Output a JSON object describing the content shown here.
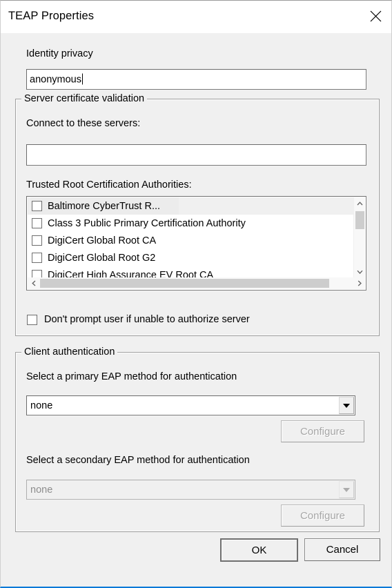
{
  "window": {
    "title": "TEAP Properties",
    "close_icon": "close-icon"
  },
  "identity_privacy": {
    "label": "Identity privacy",
    "value": "anonymous",
    "placeholder": ""
  },
  "server_certificate_validation": {
    "group_title": "Server certificate validation",
    "connect_label": "Connect to these servers:",
    "connect_value": "",
    "connect_placeholder": "",
    "trusted_roots_label": "Trusted Root Certification Authorities:",
    "trusted_roots": [
      {
        "label": "Baltimore CyberTrust R...",
        "checked": false,
        "selected": true
      },
      {
        "label": "Class 3 Public Primary Certification Authority",
        "checked": false,
        "selected": false
      },
      {
        "label": "DigiCert Global Root CA",
        "checked": false,
        "selected": false
      },
      {
        "label": "DigiCert Global Root G2",
        "checked": false,
        "selected": false
      },
      {
        "label": "DigiCert High Assurance EV Root CA",
        "checked": false,
        "selected": false
      }
    ],
    "scroll_up_icon": "chevron-up-icon",
    "scroll_down_icon": "chevron-down-icon",
    "scroll_left_icon": "chevron-left-icon",
    "scroll_right_icon": "chevron-right-icon",
    "dont_prompt_label": "Don't prompt user if unable to authorize server",
    "dont_prompt_checked": false
  },
  "client_authentication": {
    "group_title": "Client authentication",
    "primary_label": "Select a primary EAP method for authentication",
    "primary_value": "none",
    "primary_enabled": true,
    "primary_configure_label": "Configure",
    "primary_configure_enabled": false,
    "secondary_label": "Select a secondary EAP method for authentication",
    "secondary_value": "none",
    "secondary_enabled": false,
    "secondary_configure_label": "Configure",
    "secondary_configure_enabled": false,
    "dropdown_icon": "chevron-down-icon"
  },
  "footer": {
    "ok_label": "OK",
    "cancel_label": "Cancel"
  },
  "colors": {
    "dialog_bg": "#f0f0f0",
    "titlebar_bg": "#ffffff",
    "field_bg": "#ffffff",
    "accent_border": "#0078d7",
    "disabled_text": "#a6a6a6",
    "text": "#000000"
  }
}
